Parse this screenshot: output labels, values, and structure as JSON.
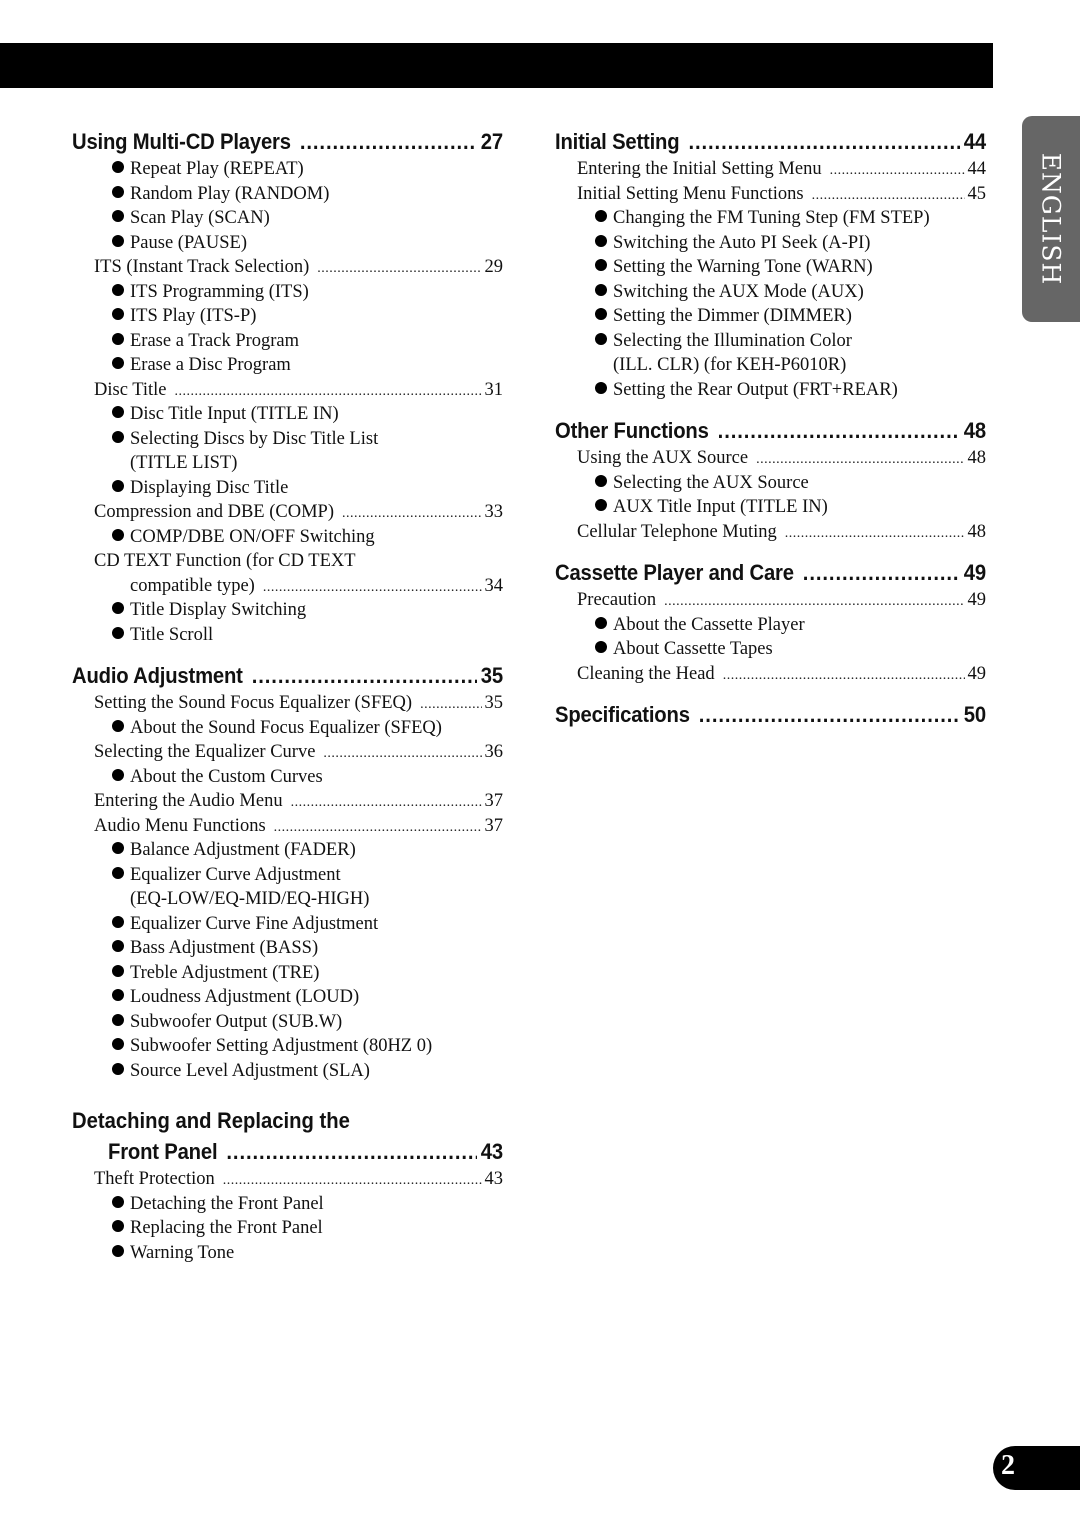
{
  "language_tab": "ENGLISH",
  "page_number": "2",
  "left_column": {
    "multi_cd": {
      "title": "Using Multi-CD Players",
      "page": "27",
      "items": [
        {
          "type": "bullet",
          "label": "Repeat Play (REPEAT)"
        },
        {
          "type": "bullet",
          "label": "Random Play (RANDOM)"
        },
        {
          "type": "bullet",
          "label": "Scan Play (SCAN)"
        },
        {
          "type": "bullet",
          "label": "Pause (PAUSE)"
        },
        {
          "type": "entry",
          "label": "ITS (Instant Track Selection)",
          "page": "29"
        },
        {
          "type": "bullet",
          "label": "ITS Programming (ITS)"
        },
        {
          "type": "bullet",
          "label": "ITS Play (ITS-P)"
        },
        {
          "type": "bullet",
          "label": "Erase a Track Program"
        },
        {
          "type": "bullet",
          "label": "Erase a Disc Program"
        },
        {
          "type": "entry",
          "label": "Disc Title",
          "page": "31"
        },
        {
          "type": "bullet",
          "label": "Disc Title Input (TITLE IN)"
        },
        {
          "type": "bullet",
          "label": "Selecting Discs by Disc Title List"
        },
        {
          "type": "bullet-cont",
          "label": "(TITLE LIST)"
        },
        {
          "type": "bullet",
          "label": "Displaying Disc Title"
        },
        {
          "type": "entry",
          "label": "Compression and DBE (COMP)",
          "page": "33"
        },
        {
          "type": "bullet",
          "label": "COMP/DBE ON/OFF Switching"
        },
        {
          "type": "plain",
          "label": "CD TEXT Function (for CD TEXT"
        },
        {
          "type": "entry-cont",
          "label": "compatible type)",
          "page": "34"
        },
        {
          "type": "bullet",
          "label": "Title Display Switching"
        },
        {
          "type": "bullet",
          "label": "Title Scroll"
        }
      ]
    },
    "audio": {
      "title": "Audio Adjustment",
      "page": "35",
      "items": [
        {
          "type": "entry",
          "label": "Setting the Sound Focus Equalizer (SFEQ)",
          "page": "35"
        },
        {
          "type": "bullet",
          "label": "About the Sound Focus Equalizer (SFEQ)"
        },
        {
          "type": "entry",
          "label": "Selecting the Equalizer Curve",
          "page": "36"
        },
        {
          "type": "bullet",
          "label": "About the Custom Curves"
        },
        {
          "type": "entry",
          "label": "Entering the Audio Menu",
          "page": "37"
        },
        {
          "type": "entry",
          "label": "Audio Menu Functions",
          "page": "37"
        },
        {
          "type": "bullet",
          "label": "Balance Adjustment (FADER)"
        },
        {
          "type": "bullet",
          "label": "Equalizer Curve Adjustment"
        },
        {
          "type": "bullet-cont",
          "label": "(EQ-LOW/EQ-MID/EQ-HIGH)"
        },
        {
          "type": "bullet",
          "label": "Equalizer Curve Fine Adjustment"
        },
        {
          "type": "bullet",
          "label": "Bass Adjustment (BASS)"
        },
        {
          "type": "bullet",
          "label": "Treble Adjustment (TRE)"
        },
        {
          "type": "bullet",
          "label": "Loudness Adjustment (LOUD)"
        },
        {
          "type": "bullet",
          "label": "Subwoofer Output (SUB.W)"
        },
        {
          "type": "bullet",
          "label": "Subwoofer Setting Adjustment (80HZ 0)"
        },
        {
          "type": "bullet",
          "label": "Source Level Adjustment (SLA)"
        }
      ]
    },
    "front_panel": {
      "title_line1": "Detaching and Replacing the",
      "title_line2": "Front Panel",
      "page": "43",
      "items": [
        {
          "type": "entry",
          "label": "Theft Protection",
          "page": "43"
        },
        {
          "type": "bullet",
          "label": "Detaching the Front Panel"
        },
        {
          "type": "bullet",
          "label": "Replacing the Front Panel"
        },
        {
          "type": "bullet",
          "label": "Warning Tone"
        }
      ]
    }
  },
  "right_column": {
    "initial": {
      "title": "Initial Setting",
      "page": "44",
      "items": [
        {
          "type": "entry",
          "label": "Entering the Initial Setting Menu",
          "page": "44"
        },
        {
          "type": "entry",
          "label": "Initial Setting Menu Functions",
          "page": "45"
        },
        {
          "type": "bullet",
          "label": "Changing the FM Tuning Step (FM STEP)"
        },
        {
          "type": "bullet",
          "label": "Switching the Auto PI Seek (A-PI)"
        },
        {
          "type": "bullet",
          "label": "Setting the Warning Tone (WARN)"
        },
        {
          "type": "bullet",
          "label": "Switching the AUX Mode (AUX)"
        },
        {
          "type": "bullet",
          "label": "Setting the Dimmer (DIMMER)"
        },
        {
          "type": "bullet",
          "label": "Selecting the Illumination Color"
        },
        {
          "type": "bullet-cont",
          "label": "(ILL. CLR) (for KEH-P6010R)"
        },
        {
          "type": "bullet",
          "label": "Setting the Rear Output (FRT+REAR)"
        }
      ]
    },
    "other": {
      "title": "Other Functions",
      "page": "48",
      "items": [
        {
          "type": "entry",
          "label": "Using the AUX Source",
          "page": "48"
        },
        {
          "type": "bullet",
          "label": "Selecting the AUX Source"
        },
        {
          "type": "bullet",
          "label": "AUX Title Input (TITLE IN)"
        },
        {
          "type": "entry",
          "label": "Cellular Telephone Muting",
          "page": "48"
        }
      ]
    },
    "cassette": {
      "title": "Cassette Player and Care",
      "page": "49",
      "items": [
        {
          "type": "entry",
          "label": "Precaution",
          "page": "49"
        },
        {
          "type": "bullet",
          "label": "About the Cassette Player"
        },
        {
          "type": "bullet",
          "label": "About Cassette Tapes"
        },
        {
          "type": "entry",
          "label": "Cleaning the Head",
          "page": "49"
        }
      ]
    },
    "specs": {
      "title": "Specifications",
      "page": "50"
    }
  }
}
